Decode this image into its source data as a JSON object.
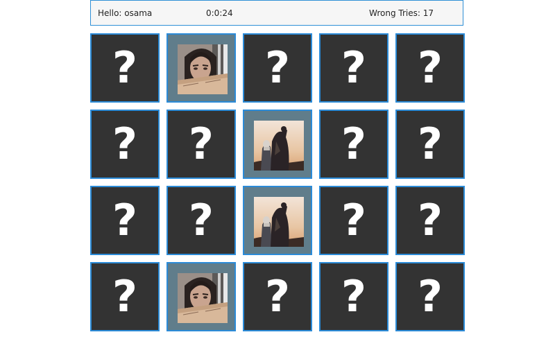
{
  "header": {
    "greeting": "Hello: osama",
    "timer": "0:0:24",
    "wrong_tries": "Wrong Tries: 17"
  },
  "board": {
    "hidden_symbol": "?",
    "cards": [
      {
        "state": "hidden"
      },
      {
        "state": "revealed",
        "image": "woman-portrait-photo"
      },
      {
        "state": "hidden"
      },
      {
        "state": "hidden"
      },
      {
        "state": "hidden"
      },
      {
        "state": "hidden"
      },
      {
        "state": "hidden"
      },
      {
        "state": "revealed",
        "image": "desert-figures-photo"
      },
      {
        "state": "hidden"
      },
      {
        "state": "hidden"
      },
      {
        "state": "hidden"
      },
      {
        "state": "hidden"
      },
      {
        "state": "revealed",
        "image": "desert-figures-photo"
      },
      {
        "state": "hidden"
      },
      {
        "state": "hidden"
      },
      {
        "state": "hidden"
      },
      {
        "state": "revealed",
        "image": "woman-portrait-photo"
      },
      {
        "state": "hidden"
      },
      {
        "state": "hidden"
      },
      {
        "state": "hidden"
      }
    ]
  },
  "colors": {
    "card_back": "#333333",
    "card_border": "#2b8bd8",
    "card_revealed_bg": "#607d8b"
  }
}
